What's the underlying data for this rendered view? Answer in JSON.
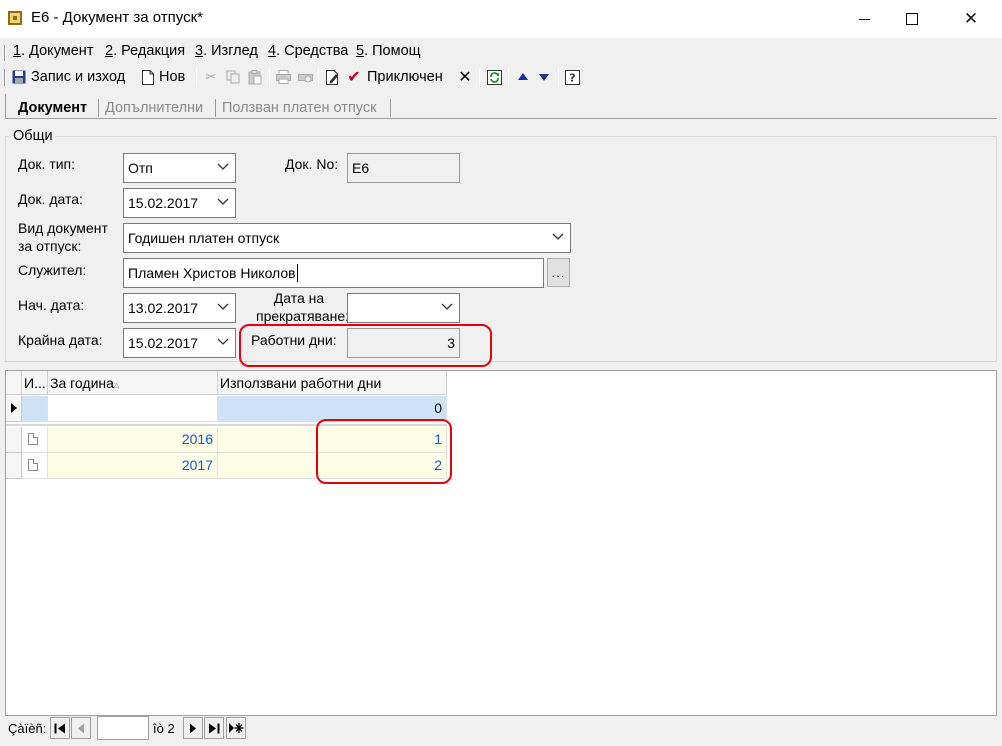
{
  "window": {
    "title": "Е6 - Документ за отпуск*",
    "minimize": "—",
    "close": "✕"
  },
  "menu": [
    {
      "key": "1",
      "rest": ". Документ"
    },
    {
      "key": "2",
      "rest": ". Редакция"
    },
    {
      "key": "3",
      "rest": ". Изглед"
    },
    {
      "key": "4",
      "rest": ". Средства"
    },
    {
      "key": "5",
      "rest": ". Помощ"
    }
  ],
  "toolbar": {
    "save_exit": "Запис и изход",
    "new": "Нов",
    "finished": "Приключен"
  },
  "tabs": [
    "Документ",
    "Допълнителни",
    "Ползван платен отпуск"
  ],
  "general": {
    "group_title": "Общи",
    "doc_type_label": "Док. тип:",
    "doc_type_value": "Отп",
    "doc_no_label": "Док. No:",
    "doc_no_value": "Е6",
    "doc_date_label": "Док. дата:",
    "doc_date_value": "15.02.2017",
    "leave_type_label_1": "Вид документ",
    "leave_type_label_2": "за отпуск:",
    "leave_type_value": "Годишен платен отпуск",
    "employee_label": "Служител:",
    "employee_value": "Пламен Христов Николов",
    "employee_btn": "...",
    "start_date_label": "Нач. дата:",
    "start_date_value": "13.02.2017",
    "termination_label_1": "Дата на",
    "termination_label_2": "прекратяване:",
    "termination_value": "",
    "end_date_label": "Крайна дата:",
    "end_date_value": "15.02.2017",
    "work_days_label": "Работни дни:",
    "work_days_value": "3"
  },
  "grid": {
    "columns": [
      "И...",
      "За година",
      "Използвани работни дни"
    ],
    "sort_marker": "▵",
    "new_row": {
      "year": "",
      "days": "0"
    },
    "rows": [
      {
        "year": "2016",
        "days": "1"
      },
      {
        "year": "2017",
        "days": "2"
      }
    ]
  },
  "navigator": {
    "label": "Çàïèñ:",
    "record_value": "",
    "of_text": "îò 2"
  }
}
